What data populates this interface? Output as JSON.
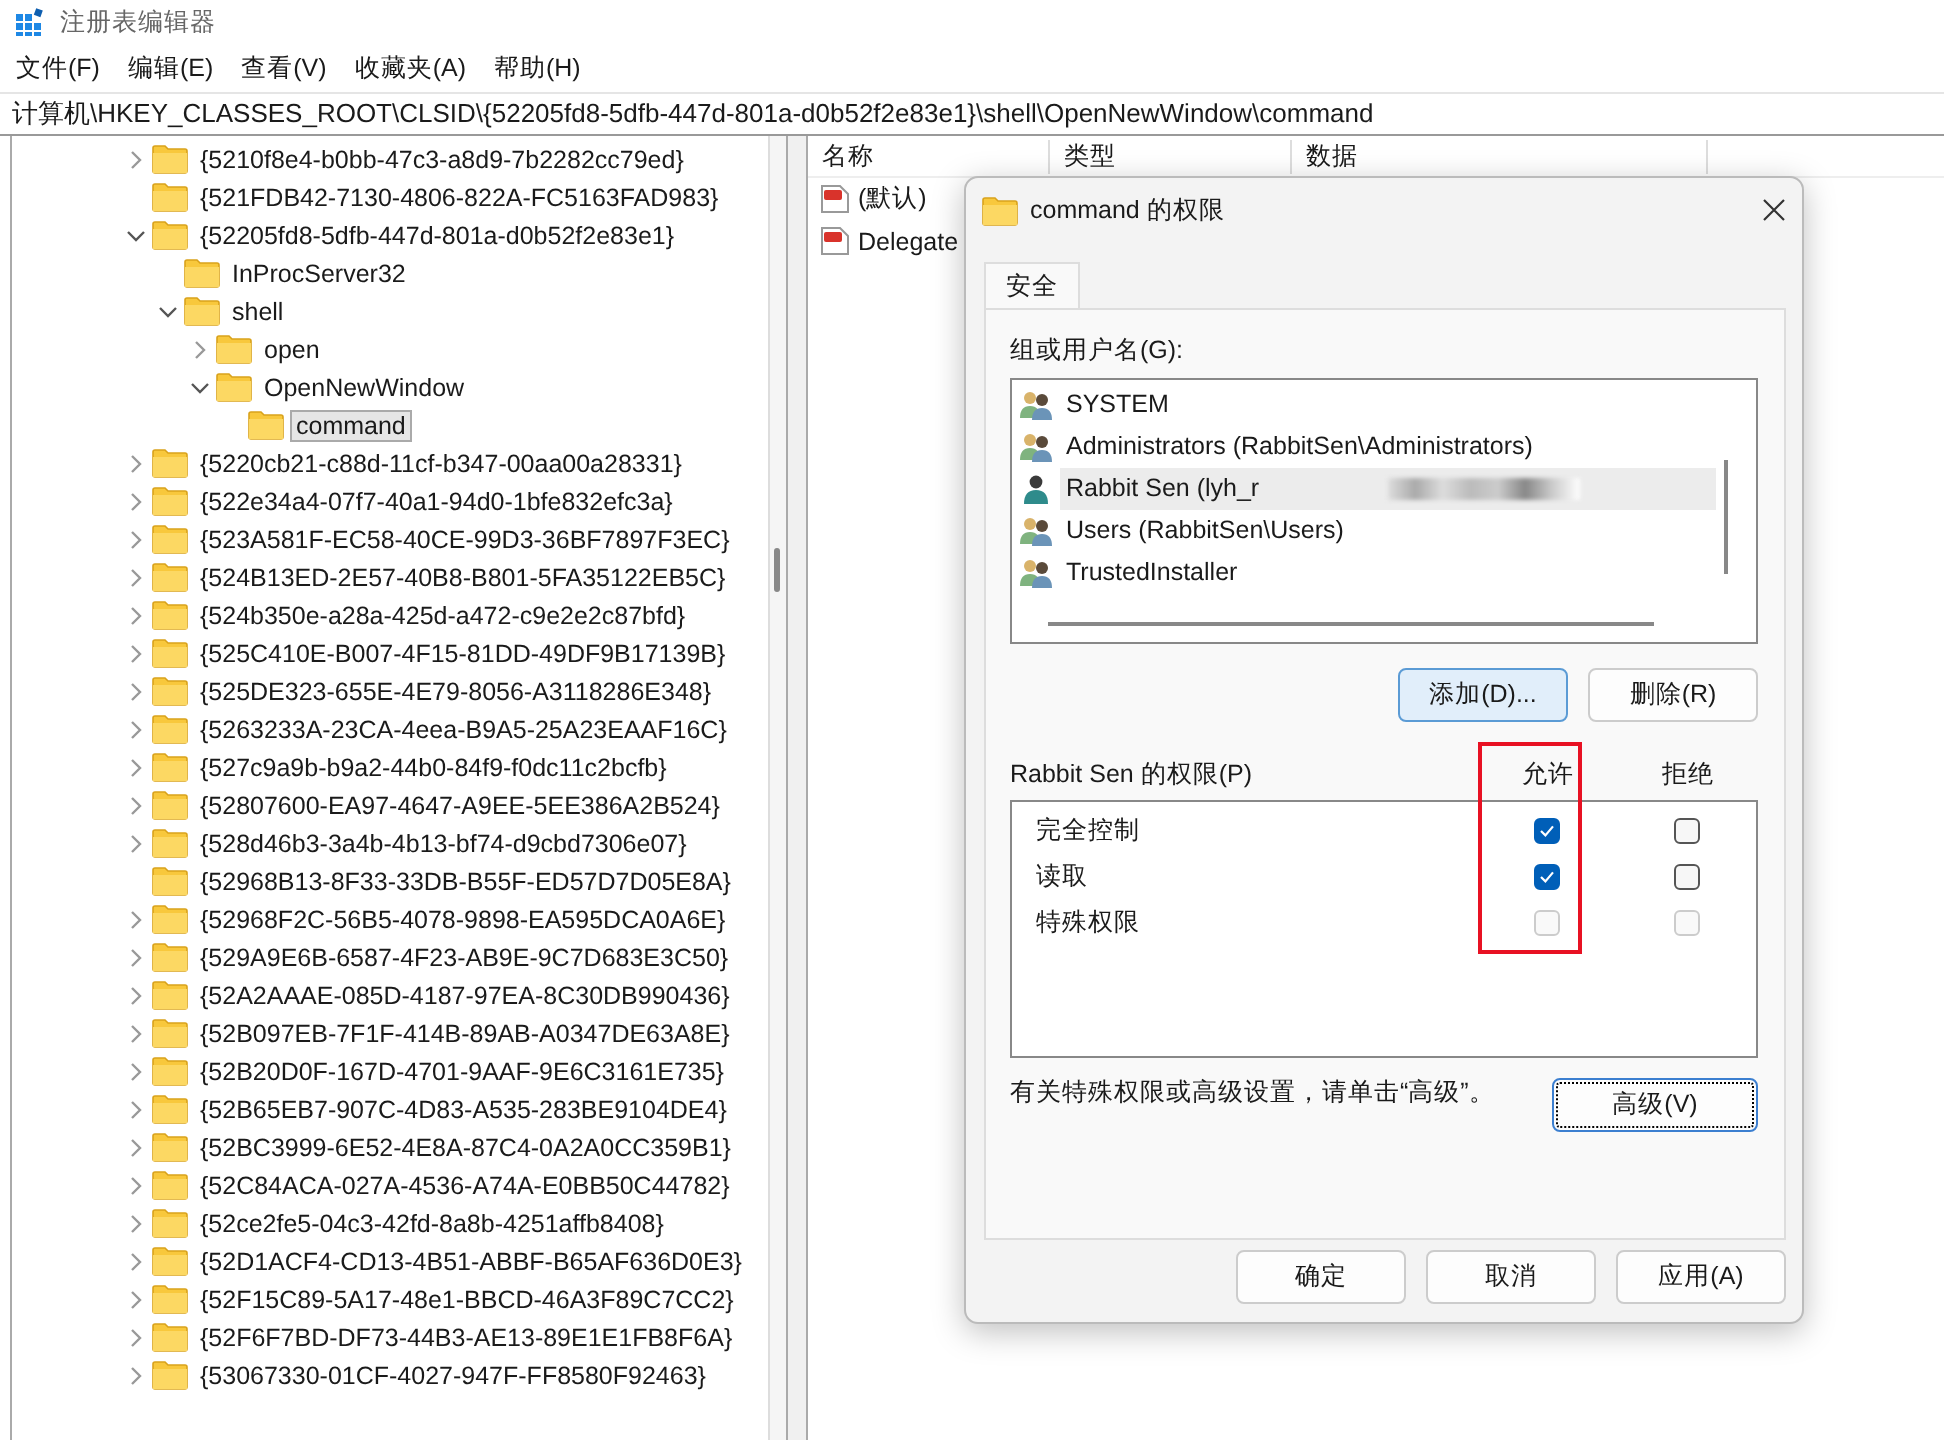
{
  "window": {
    "title": "注册表编辑器"
  },
  "menu": [
    {
      "label": "文件(F)"
    },
    {
      "label": "编辑(E)"
    },
    {
      "label": "查看(V)"
    },
    {
      "label": "收藏夹(A)"
    },
    {
      "label": "帮助(H)"
    }
  ],
  "address": "计算机\\HKEY_CLASSES_ROOT\\CLSID\\{52205fd8-5dfb-447d-801a-d0b52f2e83e1}\\shell\\OpenNewWindow\\command",
  "tree": [
    {
      "label": "{5210f8e4-b0bb-47c3-a8d9-7b2282cc79ed}",
      "kind": "branch",
      "expanded": false,
      "selected": false
    },
    {
      "label": "{521FDB42-7130-4806-822A-FC5163FAD983}",
      "kind": "leaf",
      "selected": false
    },
    {
      "label": "{52205fd8-5dfb-447d-801a-d0b52f2e83e1}",
      "kind": "branch",
      "expanded": true,
      "selected": false,
      "children": [
        {
          "label": "InProcServer32",
          "kind": "leaf",
          "selected": false
        },
        {
          "label": "shell",
          "kind": "branch",
          "expanded": true,
          "selected": false,
          "children": [
            {
              "label": "open",
              "kind": "branch",
              "expanded": false,
              "selected": false
            },
            {
              "label": "OpenNewWindow",
              "kind": "branch",
              "expanded": true,
              "selected": false,
              "children": [
                {
                  "label": "command",
                  "kind": "leaf",
                  "selected": true
                }
              ]
            }
          ]
        }
      ]
    },
    {
      "label": "{5220cb21-c88d-11cf-b347-00aa00a28331}",
      "kind": "branch",
      "expanded": false,
      "selected": false
    },
    {
      "label": "{522e34a4-07f7-40a1-94d0-1bfe832efc3a}",
      "kind": "branch",
      "expanded": false,
      "selected": false
    },
    {
      "label": "{523A581F-EC58-40CE-99D3-36BF7897F3EC}",
      "kind": "branch",
      "expanded": false,
      "selected": false
    },
    {
      "label": "{524B13ED-2E57-40B8-B801-5FA35122EB5C}",
      "kind": "branch",
      "expanded": false,
      "selected": false
    },
    {
      "label": "{524b350e-a28a-425d-a472-c9e2e2c87bfd}",
      "kind": "branch",
      "expanded": false,
      "selected": false
    },
    {
      "label": "{525C410E-B007-4F15-81DD-49DF9B17139B}",
      "kind": "branch",
      "expanded": false,
      "selected": false
    },
    {
      "label": "{525DE323-655E-4E79-8056-A3118286E348}",
      "kind": "branch",
      "expanded": false,
      "selected": false
    },
    {
      "label": "{5263233A-23CA-4eea-B9A5-25A23EAAF16C}",
      "kind": "branch",
      "expanded": false,
      "selected": false
    },
    {
      "label": "{527c9a9b-b9a2-44b0-84f9-f0dc11c2bcfb}",
      "kind": "branch",
      "expanded": false,
      "selected": false
    },
    {
      "label": "{52807600-EA97-4647-A9EE-5EE386A2B524}",
      "kind": "branch",
      "expanded": false,
      "selected": false
    },
    {
      "label": "{528d46b3-3a4b-4b13-bf74-d9cbd7306e07}",
      "kind": "branch",
      "expanded": false,
      "selected": false
    },
    {
      "label": "{52968B13-8F33-33DB-B55F-ED57D7D05E8A}",
      "kind": "leaf",
      "selected": false
    },
    {
      "label": "{52968F2C-56B5-4078-9898-EA595DCA0A6E}",
      "kind": "branch",
      "expanded": false,
      "selected": false
    },
    {
      "label": "{529A9E6B-6587-4F23-AB9E-9C7D683E3C50}",
      "kind": "branch",
      "expanded": false,
      "selected": false
    },
    {
      "label": "{52A2AAAE-085D-4187-97EA-8C30DB990436}",
      "kind": "branch",
      "expanded": false,
      "selected": false
    },
    {
      "label": "{52B097EB-7F1F-414B-89AB-A0347DE63A8E}",
      "kind": "branch",
      "expanded": false,
      "selected": false
    },
    {
      "label": "{52B20D0F-167D-4701-9AAF-9E6C3161E735}",
      "kind": "branch",
      "expanded": false,
      "selected": false
    },
    {
      "label": "{52B65EB7-907C-4D83-A535-283BE9104DE4}",
      "kind": "branch",
      "expanded": false,
      "selected": false
    },
    {
      "label": "{52BC3999-6E52-4E8A-87C4-0A2A0CC359B1}",
      "kind": "branch",
      "expanded": false,
      "selected": false
    },
    {
      "label": "{52C84ACA-027A-4536-A74A-E0BB50C44782}",
      "kind": "branch",
      "expanded": false,
      "selected": false
    },
    {
      "label": "{52ce2fe5-04c3-42fd-8a8b-4251affb8408}",
      "kind": "branch",
      "expanded": false,
      "selected": false
    },
    {
      "label": "{52D1ACF4-CD13-4B51-ABBF-B65AF636D0E3}",
      "kind": "branch",
      "expanded": false,
      "selected": false
    },
    {
      "label": "{52F15C89-5A17-48e1-BBCD-46A3F89C7CC2}",
      "kind": "branch",
      "expanded": false,
      "selected": false
    },
    {
      "label": "{52F6F7BD-DF73-44B3-AE13-89E1E1FB8F6A}",
      "kind": "branch",
      "expanded": false,
      "selected": false
    },
    {
      "label": "{53067330-01CF-4027-947F-FF8580F92463}",
      "kind": "branch",
      "expanded": false,
      "selected": false
    }
  ],
  "values": {
    "columns": [
      "名称",
      "类型",
      "数据"
    ],
    "rows": [
      {
        "name": "(默认)"
      },
      {
        "name": "Delegate"
      }
    ]
  },
  "dialog": {
    "title": "command 的权限",
    "tabs": [
      {
        "label": "安全",
        "selected": true
      }
    ],
    "users_label": "组或用户名(G):",
    "users": [
      {
        "name": "SYSTEM",
        "kind": "group",
        "selected": false,
        "redacted": false
      },
      {
        "name": "Administrators (RabbitSen\\Administrators)",
        "kind": "group",
        "selected": false,
        "redacted": false
      },
      {
        "name": "Rabbit Sen (lyh_r",
        "kind": "user",
        "selected": true,
        "redacted": true
      },
      {
        "name": "Users (RabbitSen\\Users)",
        "kind": "group",
        "selected": false,
        "redacted": false
      },
      {
        "name": "TrustedInstaller",
        "kind": "group",
        "selected": false,
        "redacted": false
      }
    ],
    "list_buttons": [
      {
        "label": "添加(D)...",
        "kind": "default"
      },
      {
        "label": "删除(R)",
        "kind": "normal"
      }
    ],
    "permissions_label": "Rabbit Sen 的权限(P)",
    "allow_label": "允许",
    "deny_label": "拒绝",
    "allow_highlighted": true,
    "permissions": [
      {
        "name": "完全控制",
        "allow": {
          "checked": true,
          "disabled": false
        },
        "deny": {
          "checked": false,
          "disabled": false
        }
      },
      {
        "name": "读取",
        "allow": {
          "checked": true,
          "disabled": false
        },
        "deny": {
          "checked": false,
          "disabled": false
        }
      },
      {
        "name": "特殊权限",
        "allow": {
          "checked": false,
          "disabled": true
        },
        "deny": {
          "checked": false,
          "disabled": true
        }
      }
    ],
    "advanced_note": "有关特殊权限或高级设置，请单击“高级”。",
    "advanced_button": {
      "label": "高级(V)",
      "kind": "focused"
    },
    "buttons": [
      {
        "label": "确定",
        "kind": "normal"
      },
      {
        "label": "取消",
        "kind": "normal"
      },
      {
        "label": "应用(A)",
        "kind": "normal"
      }
    ]
  }
}
